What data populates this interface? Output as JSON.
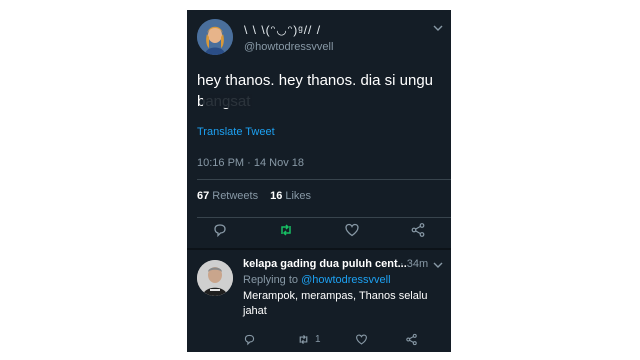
{
  "tweet": {
    "display_name": "\\ \\ \\(ᵔ◡ᵔ)ᵍ// /",
    "handle": "@howtodressvvell",
    "text_part1": "hey thanos. hey thanos. dia si ungu ",
    "text_censored": "bangsat",
    "translate": "Translate Tweet",
    "timestamp": "10:16 PM · 14 Nov 18",
    "retweets_count": "67",
    "retweets_label": "Retweets",
    "likes_count": "16",
    "likes_label": "Likes",
    "icons": [
      "reply-icon",
      "retweet-icon",
      "like-icon",
      "share-icon"
    ],
    "retweet_accent": "#17bf63"
  },
  "reply": {
    "name": "kelapa gading dua puluh cent...",
    "time": "· 34m",
    "replying_prefix": "Replying to",
    "replying_handle": "@howtodressvvell",
    "text": "Merampok, merampas, Thanos selalu jahat",
    "retweet_count": "1"
  },
  "colors": {
    "background": "#141d26",
    "link": "#1da1f2",
    "muted": "#8899a6"
  }
}
